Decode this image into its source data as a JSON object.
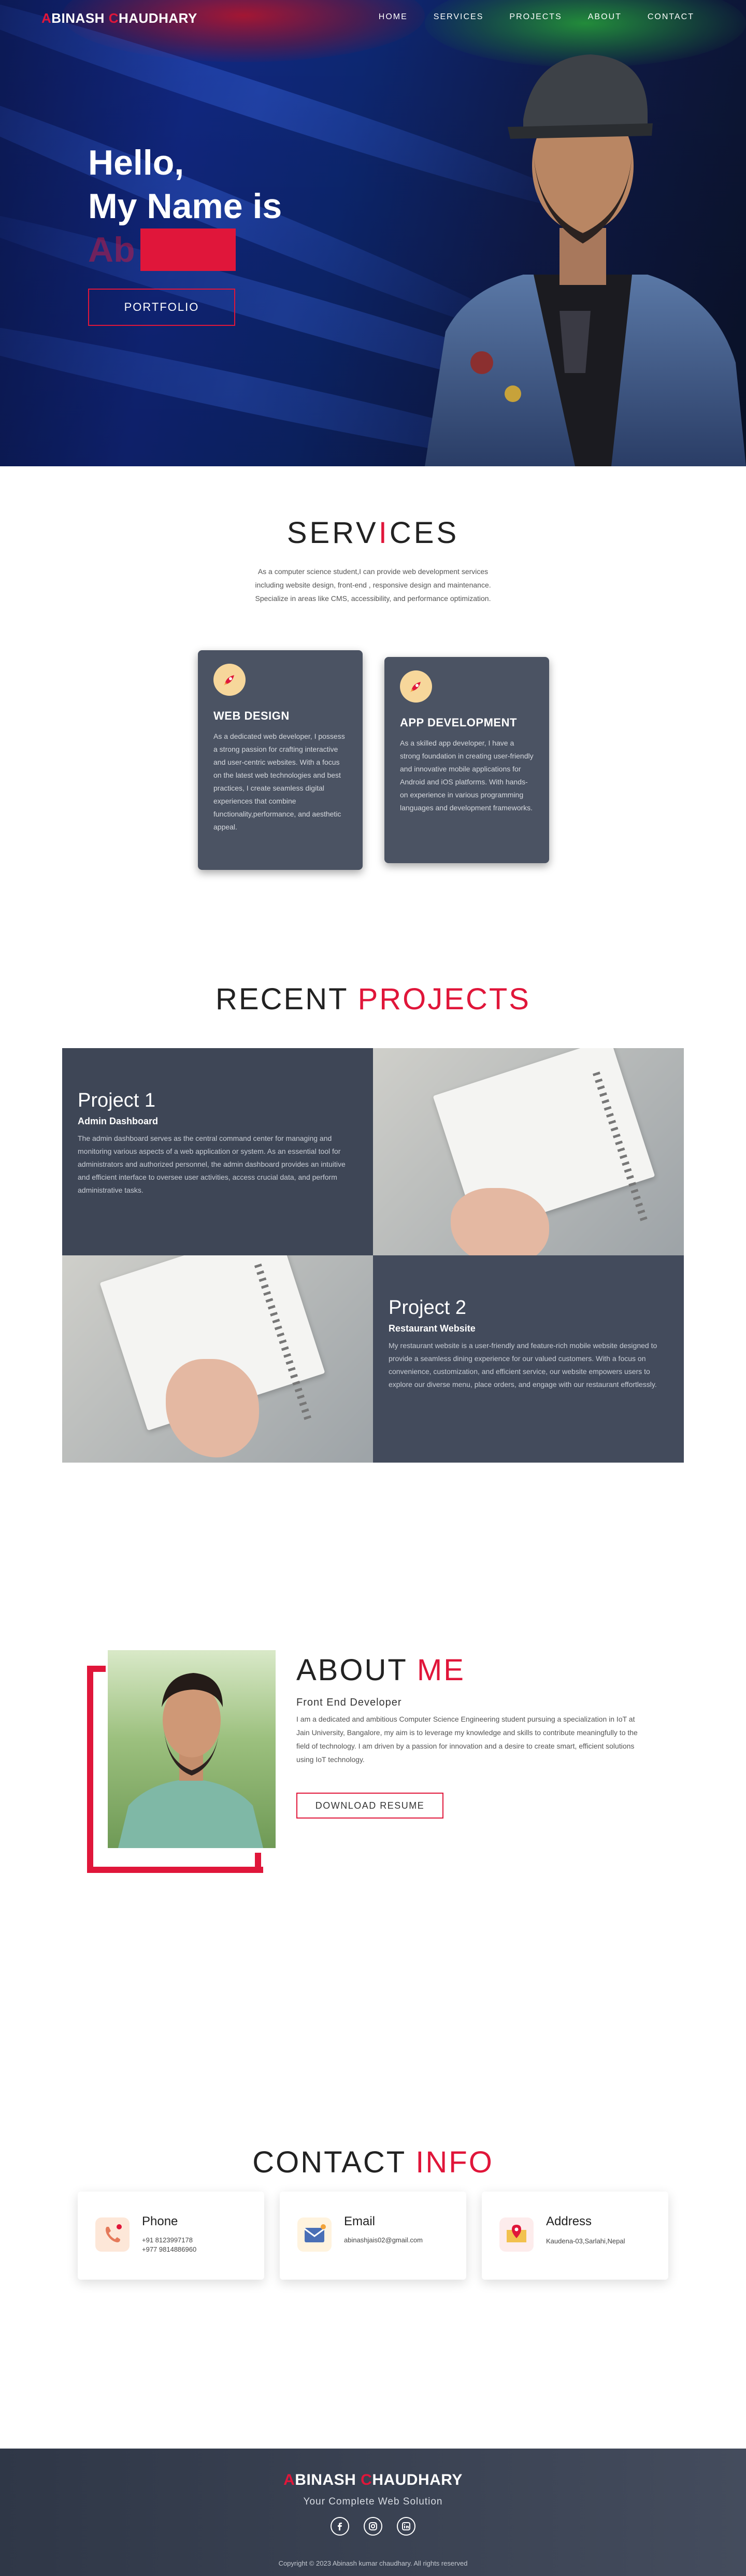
{
  "nav": {
    "logo_first_initial": "A",
    "logo_first_rest": "BINASH ",
    "logo_last_initial": "C",
    "logo_last_rest": "HAUDHARY",
    "links": [
      "HOME",
      "SERVICES",
      "PROJECTS",
      "ABOUT",
      "CONTACT"
    ]
  },
  "hero": {
    "line1": "Hello,",
    "line2": "My Name is",
    "typed": "Ab",
    "button": "PORTFOLIO"
  },
  "services": {
    "title_a": "SERV",
    "title_b": "I",
    "title_c": "CES",
    "description": "As a computer science student,I can provide web development services including website design, front-end , responsive design and maintenance. Specialize in areas like CMS, accessibility, and performance optimization.",
    "cards": [
      {
        "icon": "rocket-icon",
        "title": "WEB DESIGN",
        "text": "As a dedicated web developer, I possess a strong passion for crafting interactive and user-centric websites. With a focus on the latest web technologies and best practices, I create seamless digital experiences that combine functionality,performance, and aesthetic appeal."
      },
      {
        "icon": "rocket-icon",
        "title": "APP DEVELOPMENT",
        "text": "As a skilled app developer, I have a strong foundation in creating user-friendly and innovative mobile applications for Android and iOS platforms. With hands-on experience in various programming languages and development frameworks."
      }
    ]
  },
  "projects": {
    "title_a": "RECENT ",
    "title_b": "PROJECTS",
    "items": [
      {
        "title": "Project 1",
        "subtitle": "Admin Dashboard",
        "text": "The admin dashboard serves as the central command center for managing and monitoring various aspects of a web application or system. As an essential tool for administrators and authorized personnel, the admin dashboard provides an intuitive and efficient interface to oversee user activities, access crucial data, and perform administrative tasks."
      },
      {
        "title": "Project 2",
        "subtitle": "Restaurant Website",
        "text": "My restaurant website is a user-friendly and feature-rich mobile website designed to provide a seamless dining experience for our valued customers. With a focus on convenience, customization, and efficient service, our website empowers users to explore our diverse menu, place orders, and engage with our restaurant effortlessly."
      }
    ]
  },
  "about": {
    "title_a": "ABOUT ",
    "title_b": "ME",
    "subtitle": "Front End Developer",
    "text": "I am a dedicated and ambitious Computer Science Engineering student pursuing a specialization in IoT at Jain University, Bangalore, my aim is to leverage my knowledge and skills to contribute meaningfully to the field of technology. I am driven by a passion for innovation and a desire to create smart, efficient solutions using IoT technology.",
    "button": "DOWNLOAD RESUME"
  },
  "contact": {
    "title_a": "CONTACT ",
    "title_b": "INFO",
    "cards": [
      {
        "icon": "phone-icon",
        "title": "Phone",
        "lines": [
          "+91 8123997178",
          "+977 9814886960"
        ]
      },
      {
        "icon": "mail-icon",
        "title": "Email",
        "lines": [
          "abinashjais02@gmail.com"
        ]
      },
      {
        "icon": "map-pin-icon",
        "title": "Address",
        "lines": [
          "Kaudena-03,Sarlahi,Nepal"
        ]
      }
    ]
  },
  "footer": {
    "tagline": "Your Complete Web Solution",
    "socials": [
      "facebook-icon",
      "instagram-icon",
      "linkedin-icon"
    ],
    "copyright": "Copyright © 2023 Abinash kumar chaudhary. All rights reserved"
  },
  "colors": {
    "accent": "#e0163a",
    "card": "#4b5363",
    "footer": "#3a4252"
  }
}
